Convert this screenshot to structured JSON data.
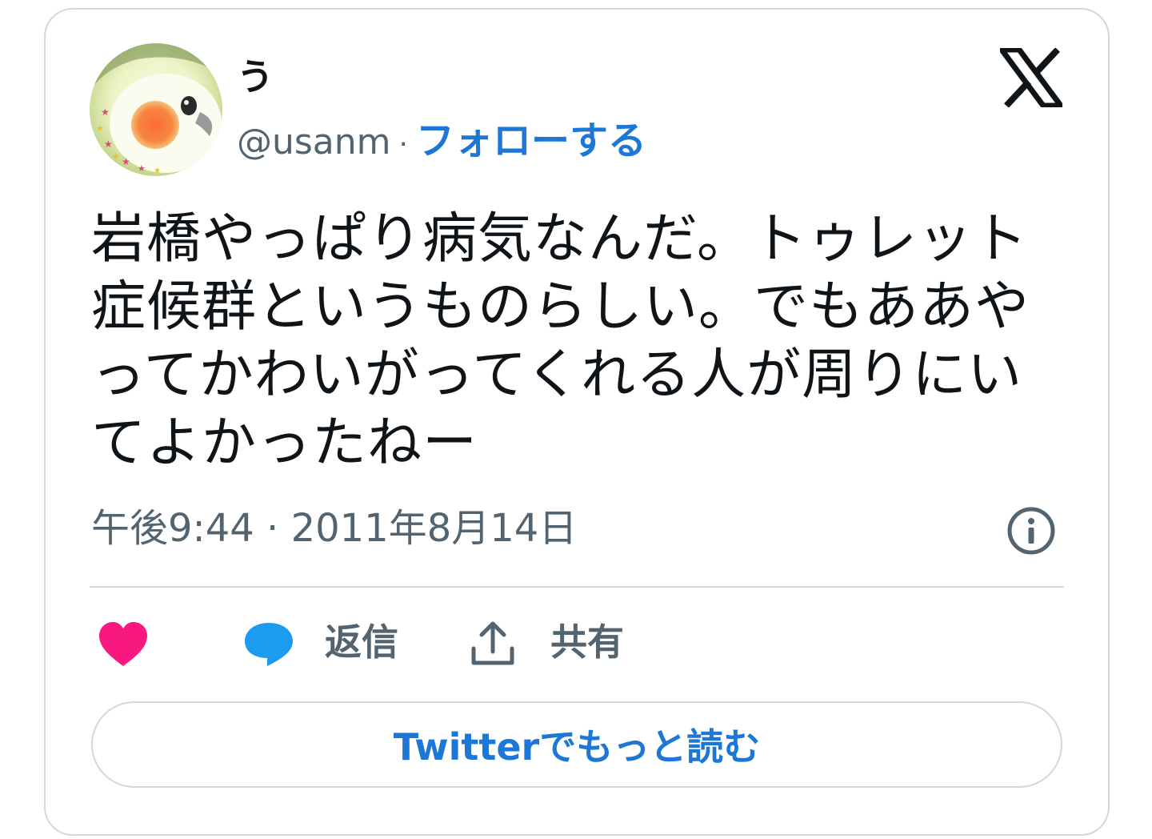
{
  "author": {
    "name": "う",
    "handle": "@usanm",
    "separator": "·",
    "follow_label": "フォローする"
  },
  "tweet": {
    "text": "岩橋やっぱり病気なんだ。トゥレット症候群というものらしい。でもああやってかわいがってくれる人が周りにいてよかったねー",
    "timestamp": "午後9:44 · 2011年8月14日"
  },
  "actions": {
    "reply_label": "返信",
    "share_label": "共有"
  },
  "read_more_label": "Twitterでもっと読む",
  "icons": {
    "logo": "x-logo-icon",
    "info": "info-icon",
    "like": "heart-icon",
    "reply": "speech-bubble-icon",
    "share": "share-upload-icon"
  },
  "colors": {
    "accent": "#1d77d6",
    "like": "#f91880",
    "reply": "#1d9bf0",
    "text": "#0f1419",
    "muted": "#536471",
    "border": "#cfd9de"
  }
}
